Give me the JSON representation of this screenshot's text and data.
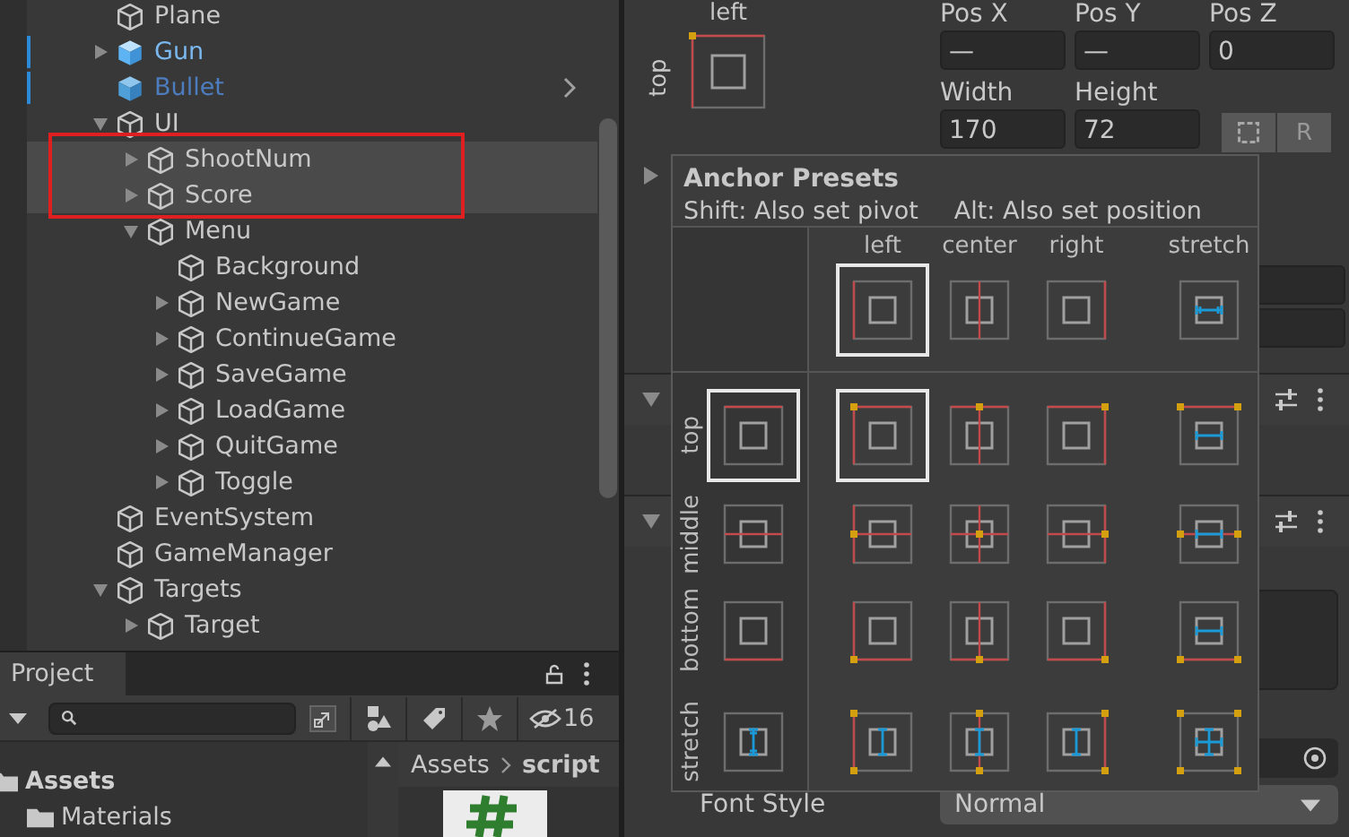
{
  "hierarchy": {
    "items": [
      {
        "name": "Plane",
        "kind": "object",
        "selected": false,
        "annotated": false
      },
      {
        "name": "Gun",
        "kind": "prefab",
        "expanded": false,
        "selected": false,
        "annotated": false
      },
      {
        "name": "Bullet",
        "kind": "prefab_dim",
        "selected": false,
        "annotated": false
      },
      {
        "name": "UI",
        "kind": "object",
        "expanded": true,
        "selected": false,
        "annotated": false,
        "children": [
          {
            "name": "ShootNum",
            "kind": "object",
            "expanded": false,
            "selected": true,
            "annotated": true
          },
          {
            "name": "Score",
            "kind": "object",
            "expanded": false,
            "selected": true,
            "annotated": true
          },
          {
            "name": "Menu",
            "kind": "object",
            "expanded": true,
            "selected": false,
            "annotated": false,
            "children": [
              {
                "name": "Background",
                "kind": "object",
                "selected": false,
                "annotated": false
              },
              {
                "name": "NewGame",
                "kind": "object",
                "expanded": false,
                "selected": false,
                "annotated": false
              },
              {
                "name": "ContinueGame",
                "kind": "object",
                "expanded": false,
                "selected": false,
                "annotated": false
              },
              {
                "name": "SaveGame",
                "kind": "object",
                "expanded": false,
                "selected": false,
                "annotated": false
              },
              {
                "name": "LoadGame",
                "kind": "object",
                "expanded": false,
                "selected": false,
                "annotated": false
              },
              {
                "name": "QuitGame",
                "kind": "object",
                "expanded": false,
                "selected": false,
                "annotated": false
              },
              {
                "name": "Toggle",
                "kind": "object",
                "expanded": false,
                "selected": false,
                "annotated": false
              }
            ]
          }
        ]
      },
      {
        "name": "EventSystem",
        "kind": "object",
        "selected": false,
        "annotated": false
      },
      {
        "name": "GameManager",
        "kind": "object",
        "selected": false,
        "annotated": false
      },
      {
        "name": "Targets",
        "kind": "object",
        "expanded": true,
        "selected": false,
        "annotated": false,
        "children": [
          {
            "name": "Target",
            "kind": "object",
            "expanded": false,
            "selected": false,
            "annotated": false
          }
        ]
      }
    ]
  },
  "project": {
    "tab": "Project",
    "hidden_count": "16",
    "tree": [
      {
        "name": "Assets",
        "expanded": true,
        "children": [
          {
            "name": "Materials"
          }
        ]
      }
    ],
    "breadcrumb": [
      "Assets",
      "script"
    ]
  },
  "inspector": {
    "anchor": {
      "h_label": "left",
      "v_label": "top"
    },
    "position": [
      {
        "label": "Pos X",
        "value": "—"
      },
      {
        "label": "Pos Y",
        "value": "—"
      },
      {
        "label": "Pos Z",
        "value": "0"
      }
    ],
    "size": [
      {
        "label": "Width",
        "value": "170"
      },
      {
        "label": "Height",
        "value": "72"
      }
    ],
    "raw_button": "R",
    "font_style": {
      "label": "Font Style",
      "value": "Normal"
    }
  },
  "anchor_presets": {
    "title": "Anchor Presets",
    "hints": [
      "Shift: Also set pivot",
      "Alt: Also set position"
    ],
    "columns": [
      {
        "label": "left",
        "selected": true
      },
      {
        "label": "center",
        "selected": false
      },
      {
        "label": "right",
        "selected": false
      },
      {
        "label": "stretch",
        "selected": false
      }
    ],
    "rows": [
      {
        "label": "top",
        "selected": true,
        "cells": [
          {
            "selected": true
          },
          {
            "selected": false
          },
          {
            "selected": false
          },
          {
            "selected": false
          }
        ]
      },
      {
        "label": "middle",
        "selected": false,
        "cells": [
          {
            "selected": false
          },
          {
            "selected": false
          },
          {
            "selected": false
          },
          {
            "selected": false
          }
        ]
      },
      {
        "label": "bottom",
        "selected": false,
        "cells": [
          {
            "selected": false
          },
          {
            "selected": false
          },
          {
            "selected": false
          },
          {
            "selected": false
          }
        ]
      },
      {
        "label": "stretch",
        "selected": false,
        "cells": [
          {
            "selected": false
          },
          {
            "selected": false
          },
          {
            "selected": false
          },
          {
            "selected": false
          }
        ]
      }
    ]
  }
}
